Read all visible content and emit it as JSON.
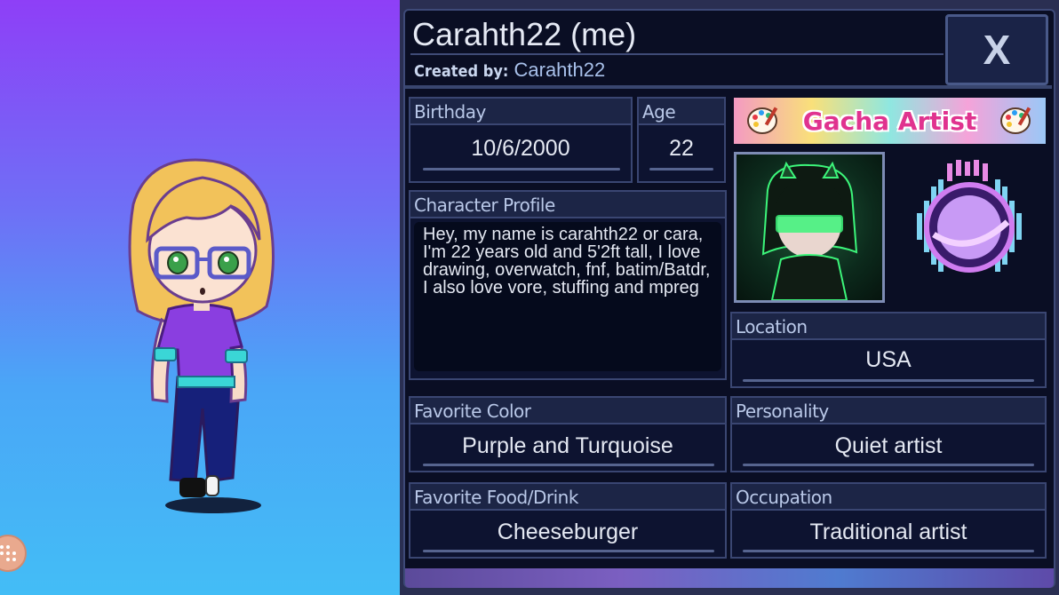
{
  "profile": {
    "title": "Carahth22 (me)",
    "created_by_label": "Created by:",
    "created_by_value": "Carahth22",
    "close_label": "X"
  },
  "fields": {
    "birthday": {
      "label": "Birthday",
      "value": "10/6/2000"
    },
    "age": {
      "label": "Age",
      "value": "22"
    },
    "character_profile": {
      "label": "Character Profile",
      "text": "Hey, my name is carahth22 or cara, I'm 22 years old and 5'2ft tall, I love drawing, overwatch, fnf, batim/Batdr, I also love vore, stuffing and mpreg"
    },
    "location": {
      "label": "Location",
      "value": "USA"
    },
    "favorite_color": {
      "label": "Favorite Color",
      "value": "Purple and Turquoise"
    },
    "personality": {
      "label": "Personality",
      "value": "Quiet artist"
    },
    "favorite_food": {
      "label": "Favorite Food/Drink",
      "value": "Cheeseburger"
    },
    "occupation": {
      "label": "Occupation",
      "value": "Traditional artist"
    }
  },
  "banner": {
    "text": "Gacha Artist"
  },
  "icons": {
    "close": "close-icon",
    "menu": "dots-grid-icon",
    "palette": "palette-icon",
    "badge": "planet-badge-icon"
  },
  "colors": {
    "panel_bg": "#0a0e24",
    "field_border": "#3a4672",
    "stage_top": "#8e3ff7",
    "stage_bottom": "#43bdf6",
    "banner_text": "#e0338f"
  }
}
